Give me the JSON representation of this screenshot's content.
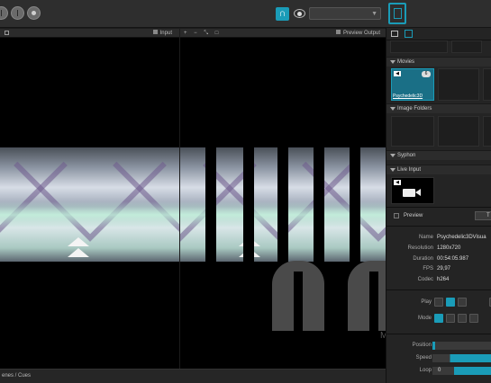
{
  "panels": {
    "input_label": "Input",
    "output_label": "Preview Output",
    "scenes_label": "enes / Cues"
  },
  "sidebar": {
    "sections": {
      "movies": "Movies",
      "image_folders": "Image Folders",
      "syphon": "Syphon",
      "live_input": "Live Input"
    },
    "movie_badge": "6",
    "movie_name": "Psychedelic3D",
    "preview_label": "Preview",
    "preview_trail": "T",
    "info": {
      "name_label": "Name",
      "name_value": "Psychedelic3DVisua",
      "resolution_label": "Resolution",
      "resolution_value": "1280x720",
      "duration_label": "Duration",
      "duration_value": "00:54:05.987",
      "fps_label": "FPS",
      "fps_value": "29,97",
      "codec_label": "Codec",
      "codec_value": "h264"
    },
    "play_label": "Play",
    "mode_label": "Mode",
    "position_label": "Position",
    "speed_label": "Speed",
    "loop_label": "Loop",
    "loop_value": "0",
    "watermark_letter": "M"
  },
  "colors": {
    "accent": "#1a9cb8"
  }
}
